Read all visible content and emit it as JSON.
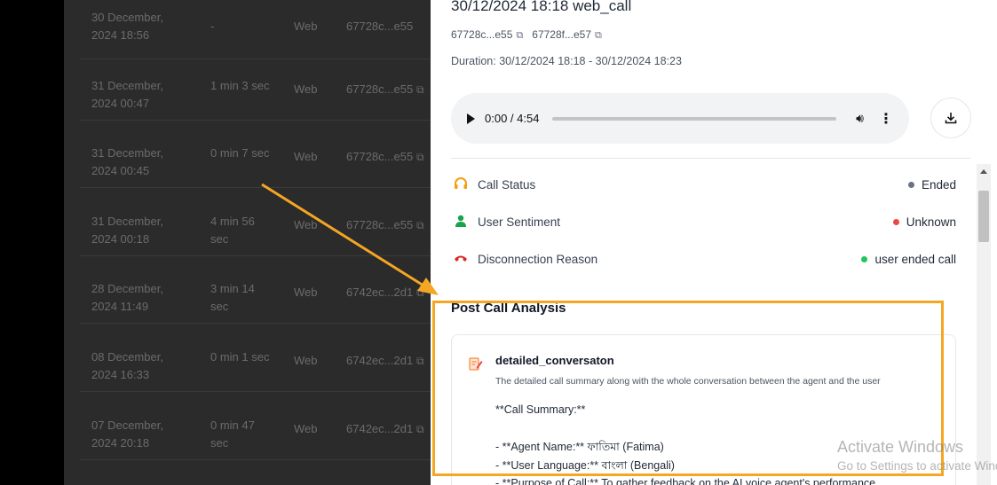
{
  "call_list": {
    "rows": [
      {
        "date": "30 December, 2024 18:56",
        "duration": "-",
        "type": "Web",
        "id": "67728c...e55",
        "copy_icon": "copy-icon"
      },
      {
        "date": "31 December, 2024 00:47",
        "duration": "1 min 3 sec",
        "type": "Web",
        "id": "67728c...e55",
        "copy_icon": "copy-icon"
      },
      {
        "date": "31 December, 2024 00:45",
        "duration": "0 min 7 sec",
        "type": "Web",
        "id": "67728c...e55",
        "copy_icon": "copy-icon"
      },
      {
        "date": "31 December, 2024 00:18",
        "duration": "4 min 56 sec",
        "type": "Web",
        "id": "67728c...e55",
        "copy_icon": "copy-icon"
      },
      {
        "date": "28 December, 2024 11:49",
        "duration": "3 min 14 sec",
        "type": "Web",
        "id": "6742ec...2d1",
        "copy_icon": "copy-icon"
      },
      {
        "date": "08 December, 2024 16:33",
        "duration": "0 min 1 sec",
        "type": "Web",
        "id": "6742ec...2d1",
        "copy_icon": "copy-icon"
      },
      {
        "date": "07 December, 2024 20:18",
        "duration": "0 min 47 sec",
        "type": "Web",
        "id": "6742ec...2d1",
        "copy_icon": "copy-icon"
      }
    ]
  },
  "detail": {
    "title": "30/12/2024 18:18 web_call",
    "id1": "67728c...e55",
    "id2": "67728f...e57",
    "duration": "Duration: 30/12/2024 18:18 - 30/12/2024 18:23",
    "audio": {
      "time": "0:00 / 4:54",
      "progress": 0.0
    },
    "status": [
      {
        "label": "Call Status",
        "value": "Ended",
        "dot_color": "#6b7280",
        "icon": "headset-icon",
        "icon_color": "#f59e0b"
      },
      {
        "label": "User Sentiment",
        "value": "Unknown",
        "dot_color": "#ef4444",
        "icon": "user-icon",
        "icon_color": "#16a34a"
      },
      {
        "label": "Disconnection Reason",
        "value": "user ended call",
        "dot_color": "#22c55e",
        "icon": "hangup-phone-icon",
        "icon_color": "#dc2626"
      }
    ],
    "post_call_analysis": {
      "title": "Post Call Analysis",
      "item_name": "detailed_conversaton",
      "item_description": "The detailed call summary along with the whole conversation between the agent and the user",
      "lines": [
        "**Call Summary:**",
        "",
        "- **Agent Name:** ফাতিমা (Fatima)",
        "- **User Language:** বাংলা (Bengali)",
        "- **Purpose of Call:** To gather feedback on the AI voice agent's performance"
      ]
    }
  },
  "watermark": {
    "line1": "Activate Windows",
    "line2": "Go to Settings to activate Windows."
  },
  "colors": {
    "annotation": "#f5a623"
  }
}
